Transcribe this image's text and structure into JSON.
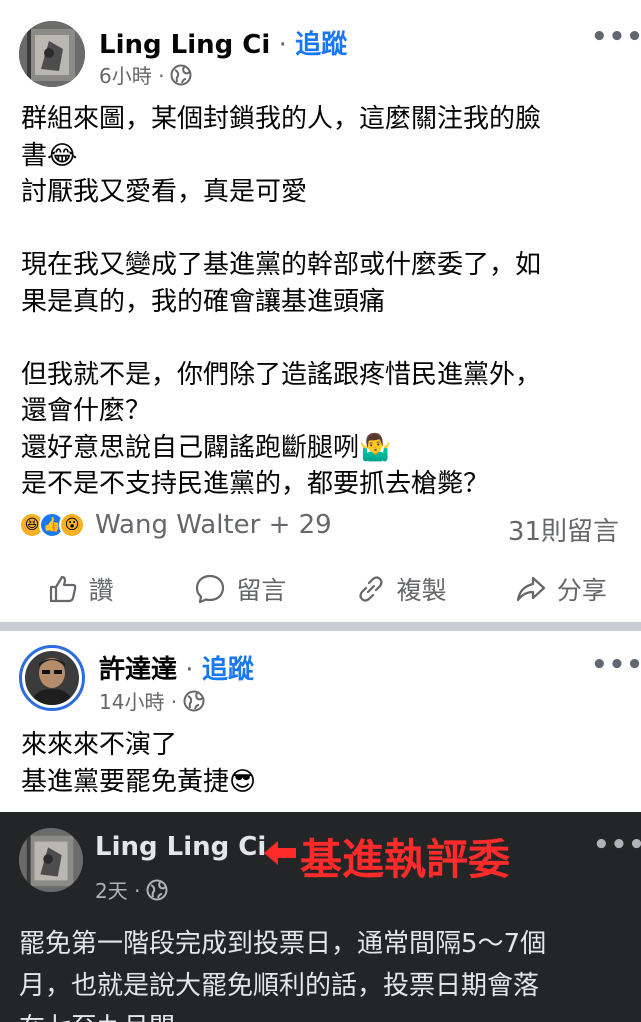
{
  "post1": {
    "author": "Ling Ling Ci",
    "separator": " · ",
    "follow": "追蹤",
    "time": "6小時 ·",
    "body": "群組來圖，某個封鎖我的人，這麼關注我的臉\n書😂\n討厭我又愛看，真是可愛\n\n現在我又變成了基進黨的幹部或什麼委了，如\n果是真的，我的確會讓基進頭痛\n\n但我就不是，你們除了造謠跟疼惜民進黨外，\n還會什麼？\n還好意思說自己闢謠跑斷腿咧🤷‍♂️\n是不是不支持民進黨的，都要抓去槍斃？",
    "reaction_emojis": [
      "😆",
      "👍",
      "😮"
    ],
    "reaction_names": "Wang Walter + 29",
    "comment_count": "31則留言",
    "actions": {
      "like": "讚",
      "comment": "留言",
      "copy": "複製",
      "share": "分享"
    },
    "more_icon": "ellipsis-icon"
  },
  "post2": {
    "author": "許達達",
    "separator": " · ",
    "follow": "追蹤",
    "time": "14小時 ·",
    "body": "來來來不演了\n基進黨要罷免黃捷😎",
    "more_icon": "ellipsis-icon"
  },
  "post3": {
    "author": "Ling Ling Ci",
    "annotation": "基進執評委",
    "time": "2天 ·",
    "body": "罷免第一階段完成到投票日，通常間隔5～7個\n月，也就是說大罷免順利的話，投票日期會落\n在七至九月間",
    "more_icon": "ellipsis-icon",
    "annotation_color": "#ff2a2a"
  },
  "colors": {
    "accent": "#1877f2",
    "secondary_text": "#65676b",
    "dark_bg": "#242526",
    "gap": "#c9ccd1"
  }
}
